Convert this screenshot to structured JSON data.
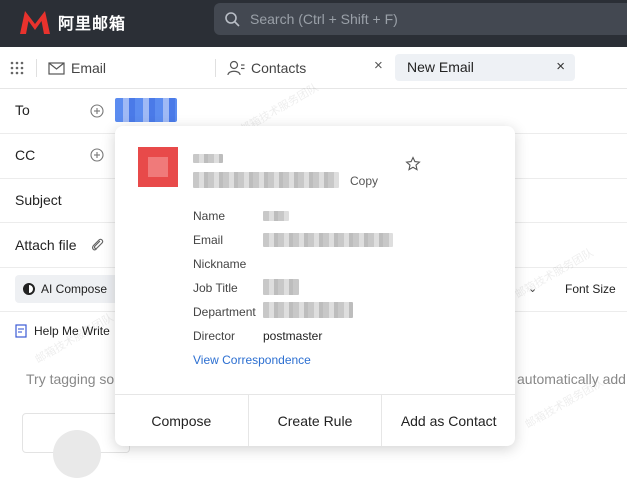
{
  "header": {
    "logo_text": "阿里邮箱",
    "search_placeholder": "Search (Ctrl + Shift + F)"
  },
  "tabs": {
    "email_label": "Email",
    "contacts_label": "Contacts",
    "contacts_close": "×",
    "active_label": "New Email",
    "active_close": "×"
  },
  "compose": {
    "to_label": "To",
    "cc_label": "CC",
    "subject_label": "Subject",
    "attach_label": "Attach file",
    "ai_compose_label": "AI Compose",
    "font_size_label": "Font Size",
    "help_label": "Help Me Write",
    "hint_left": "Try tagging so",
    "hint_right": "automatically add th"
  },
  "popup": {
    "copy_label": "Copy",
    "fields": {
      "name": "Name",
      "email": "Email",
      "nickname": "Nickname",
      "job_title": "Job Title",
      "department": "Department",
      "director": "Director"
    },
    "director_value": "postmaster",
    "view_link": "View Correspondence",
    "actions": {
      "compose": "Compose",
      "create_rule": "Create Rule",
      "add_contact": "Add as Contact"
    }
  },
  "watermark": "邮箱技术服务团队",
  "colors": {
    "topbar": "#2b2f36",
    "brand_red": "#e8322d",
    "link": "#2c6fd1"
  }
}
